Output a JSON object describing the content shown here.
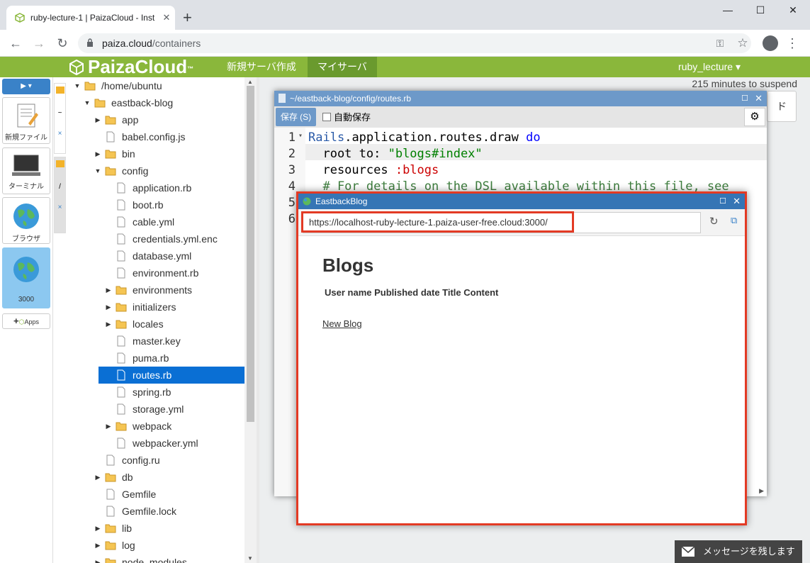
{
  "browser": {
    "tab_title": "ruby-lecture-1 | PaizaCloud - Inst",
    "url_domain": "paiza.cloud",
    "url_path": "/containers"
  },
  "paiza": {
    "logo": "PaizaCloud",
    "logo_tm": "™",
    "menu_new": "新規サーバ作成",
    "menu_my": "マイサーバ",
    "user": "ruby_lecture ▾"
  },
  "launcher": {
    "new_file": "新規ファイル",
    "terminal": "ターミナル",
    "browser": "ブラウザ",
    "port": "3000",
    "apps": "Apps"
  },
  "tree": [
    {
      "name": "/home/ubuntu",
      "depth": 0,
      "type": "folder",
      "open": true
    },
    {
      "name": "eastback-blog",
      "depth": 1,
      "type": "folder",
      "open": true
    },
    {
      "name": "app",
      "depth": 2,
      "type": "folder",
      "open": false
    },
    {
      "name": "babel.config.js",
      "depth": 2,
      "type": "file"
    },
    {
      "name": "bin",
      "depth": 2,
      "type": "folder",
      "open": false
    },
    {
      "name": "config",
      "depth": 2,
      "type": "folder",
      "open": true
    },
    {
      "name": "application.rb",
      "depth": 3,
      "type": "file"
    },
    {
      "name": "boot.rb",
      "depth": 3,
      "type": "file"
    },
    {
      "name": "cable.yml",
      "depth": 3,
      "type": "file"
    },
    {
      "name": "credentials.yml.enc",
      "depth": 3,
      "type": "file"
    },
    {
      "name": "database.yml",
      "depth": 3,
      "type": "file"
    },
    {
      "name": "environment.rb",
      "depth": 3,
      "type": "file"
    },
    {
      "name": "environments",
      "depth": 3,
      "type": "folder",
      "open": false
    },
    {
      "name": "initializers",
      "depth": 3,
      "type": "folder",
      "open": false
    },
    {
      "name": "locales",
      "depth": 3,
      "type": "folder",
      "open": false
    },
    {
      "name": "master.key",
      "depth": 3,
      "type": "file"
    },
    {
      "name": "puma.rb",
      "depth": 3,
      "type": "file"
    },
    {
      "name": "routes.rb",
      "depth": 3,
      "type": "file",
      "selected": true
    },
    {
      "name": "spring.rb",
      "depth": 3,
      "type": "file"
    },
    {
      "name": "storage.yml",
      "depth": 3,
      "type": "file"
    },
    {
      "name": "webpack",
      "depth": 3,
      "type": "folder",
      "open": false
    },
    {
      "name": "webpacker.yml",
      "depth": 3,
      "type": "file"
    },
    {
      "name": "config.ru",
      "depth": 2,
      "type": "file"
    },
    {
      "name": "db",
      "depth": 2,
      "type": "folder",
      "open": false
    },
    {
      "name": "Gemfile",
      "depth": 2,
      "type": "file"
    },
    {
      "name": "Gemfile.lock",
      "depth": 2,
      "type": "file"
    },
    {
      "name": "lib",
      "depth": 2,
      "type": "folder",
      "open": false
    },
    {
      "name": "log",
      "depth": 2,
      "type": "folder",
      "open": false
    },
    {
      "name": "node_modules",
      "depth": 2,
      "type": "folder",
      "open": false
    }
  ],
  "workspace": {
    "suspend": "215 minutes to suspend",
    "bg_button": "ド"
  },
  "editor": {
    "title": "~/eastback-blog/config/routes.rb",
    "save": "保存 (S)",
    "autosave": "自動保存",
    "lines": [
      [
        [
          "cn",
          "Rails"
        ],
        [
          "",
          "."
        ],
        [
          "",
          "application"
        ],
        [
          "",
          "."
        ],
        [
          "",
          "routes"
        ],
        [
          "",
          "."
        ],
        [
          "",
          "draw "
        ],
        [
          "k",
          "do"
        ]
      ],
      [
        [
          "",
          "  root to: "
        ],
        [
          "s",
          "\"blogs#index\""
        ]
      ],
      [
        [
          "",
          "  resources "
        ],
        [
          "sym",
          ":blogs"
        ]
      ],
      [
        [
          "c",
          "  # For details on the DSL available within this file, see"
        ]
      ],
      [
        [
          "",
          ""
        ]
      ],
      [
        [
          "",
          ""
        ]
      ]
    ],
    "line_numbers": [
      "1",
      "2",
      "3",
      "4",
      "5",
      "6"
    ]
  },
  "browser_window": {
    "title": "EastbackBlog",
    "url": "https://localhost-ruby-lecture-1.paiza-user-free.cloud:3000/",
    "heading": "Blogs",
    "table_header": "User name Published date Title Content",
    "new_link": "New Blog"
  },
  "message": {
    "label": "メッセージを残します"
  }
}
